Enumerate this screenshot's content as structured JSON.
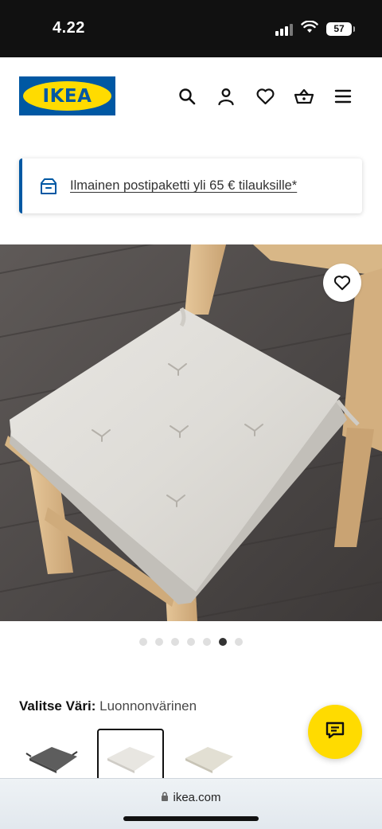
{
  "status_bar": {
    "time": "4.22",
    "battery": "57",
    "icons": [
      "cellular-signal-icon",
      "wifi-icon",
      "battery-icon"
    ]
  },
  "header": {
    "logo_text": "IKEA",
    "icons": [
      "search-icon",
      "account-icon",
      "heart-icon",
      "shopping-basket-icon",
      "menu-icon"
    ]
  },
  "promo": {
    "text": "Ilmainen postipaketti yli 65 € tilauksille*",
    "icon": "delivery-box-icon"
  },
  "product": {
    "image_alt": "Seat cushion on wooden chair",
    "favorite_icon": "heart-icon"
  },
  "carousel": {
    "total": 7,
    "active_index": 5
  },
  "color_select": {
    "label": "Valitse Väri:",
    "value": "Luonnonvärinen",
    "swatches": [
      "dark grey",
      "natural",
      "beige"
    ],
    "selected_index": 1
  },
  "chat": {
    "icon": "chat-icon"
  },
  "browser": {
    "url": "ikea.com",
    "icon": "lock-icon"
  },
  "colors": {
    "ikea_blue": "#0058a3",
    "ikea_yellow": "#ffdb00",
    "status_bar_bg": "#111111"
  }
}
